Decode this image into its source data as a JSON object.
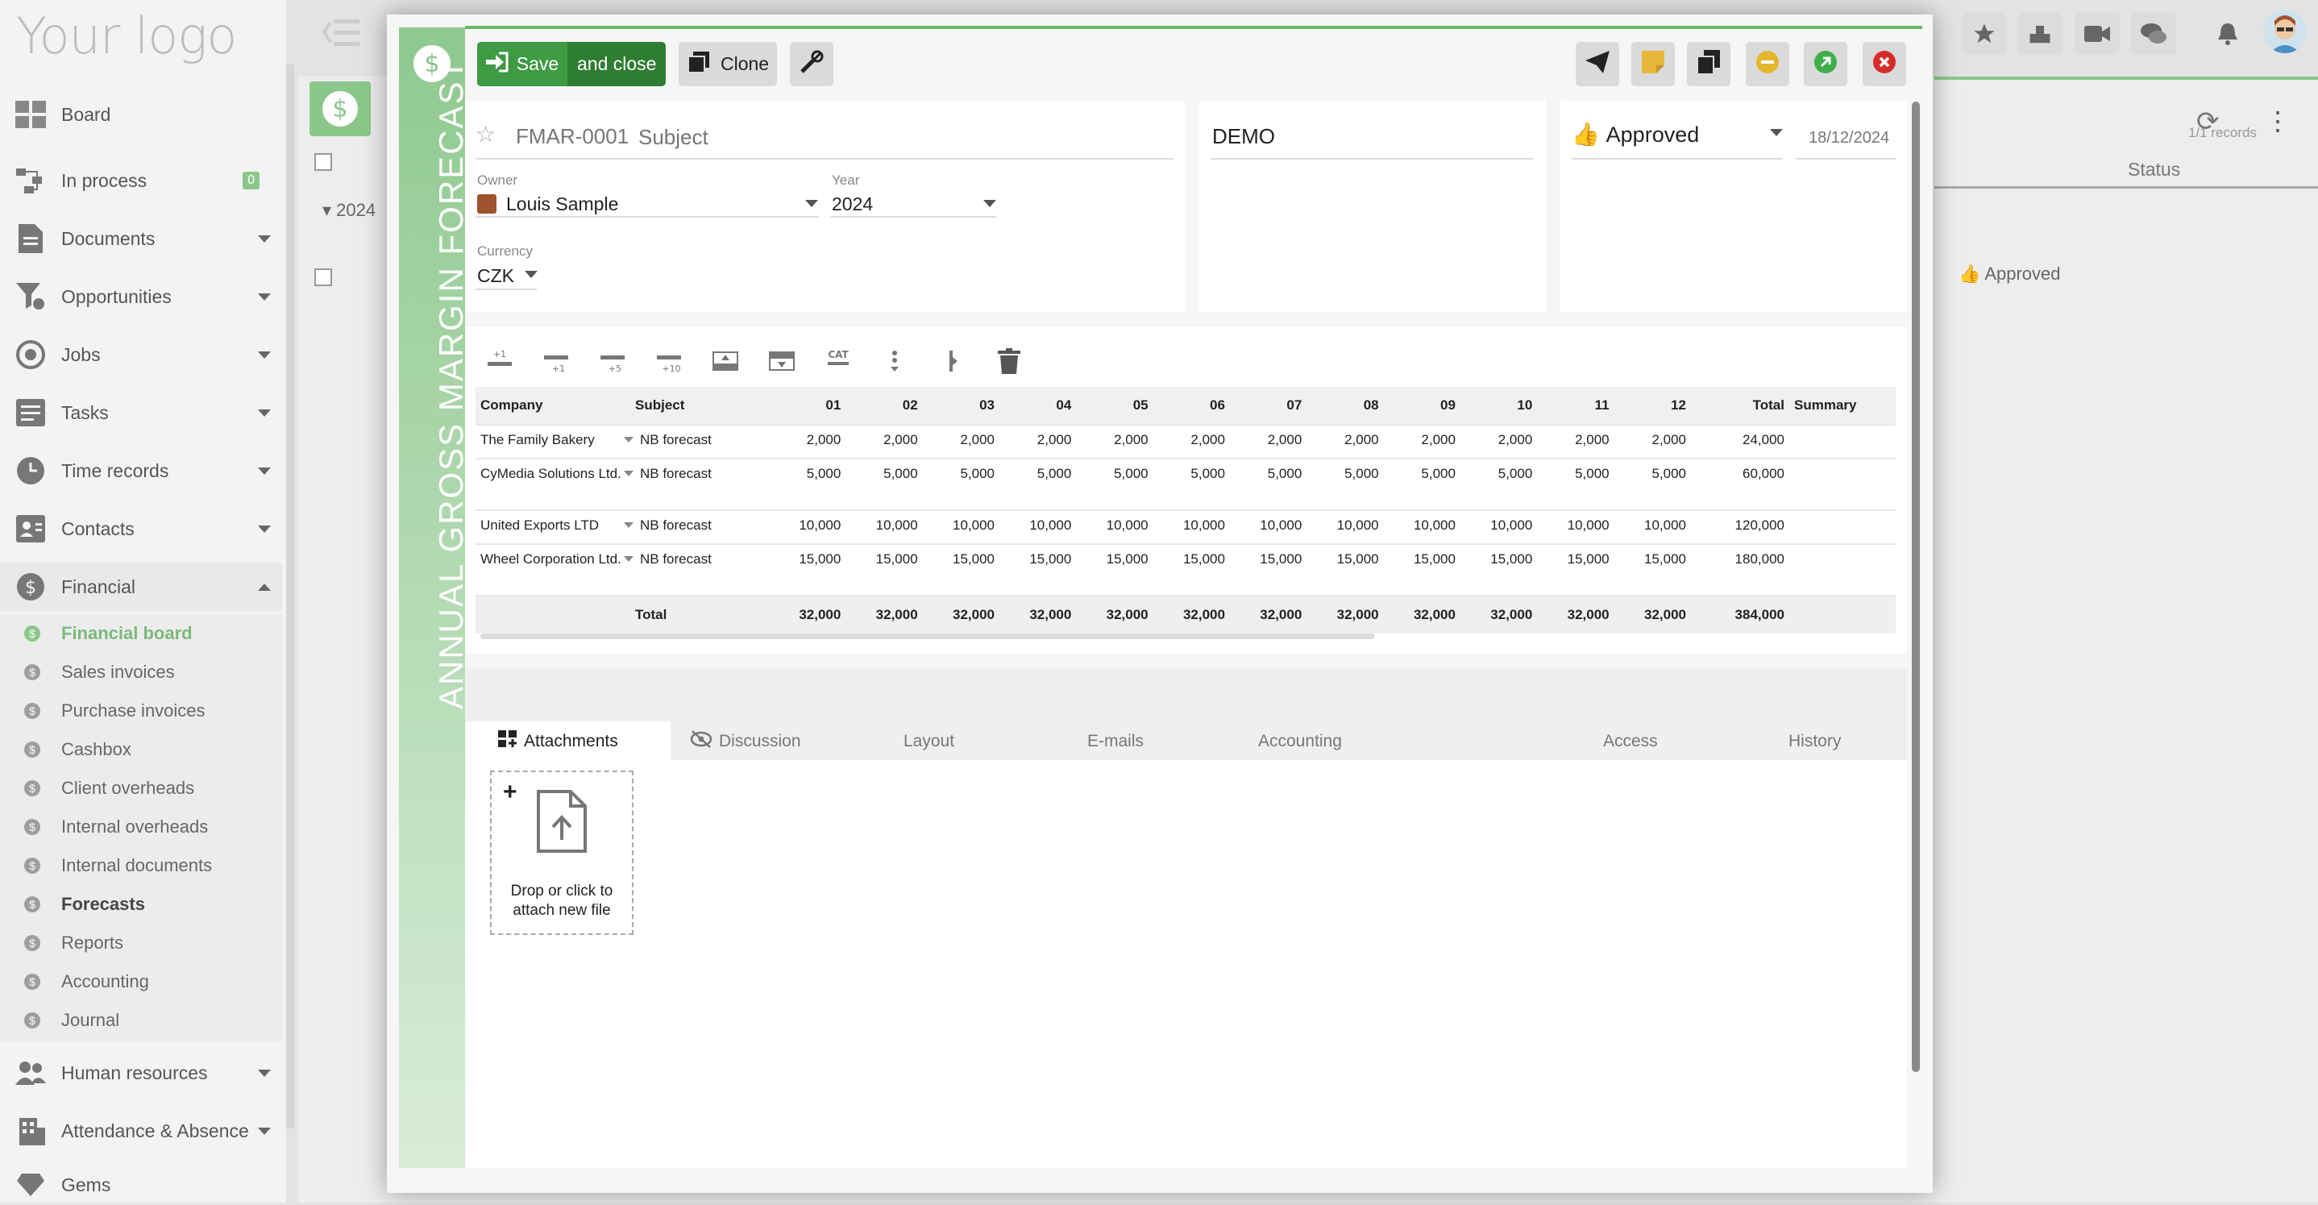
{
  "logo": "Your logo",
  "sidebar": {
    "items": [
      {
        "label": "Board",
        "icon": "board-icon"
      },
      {
        "label": "In process",
        "icon": "process-icon",
        "badge": "0"
      },
      {
        "label": "Documents",
        "icon": "document-icon"
      },
      {
        "label": "Opportunities",
        "icon": "funnel-icon"
      },
      {
        "label": "Jobs",
        "icon": "target-icon"
      },
      {
        "label": "Tasks",
        "icon": "tasks-icon"
      },
      {
        "label": "Time records",
        "icon": "clock-icon"
      },
      {
        "label": "Contacts",
        "icon": "contacts-icon"
      },
      {
        "label": "Financial",
        "icon": "dollar-icon"
      }
    ],
    "financial_sub": [
      "Financial board",
      "Sales invoices",
      "Purchase invoices",
      "Cashbox",
      "Client overheads",
      "Internal overheads",
      "Internal documents",
      "Forecasts",
      "Reports",
      "Accounting",
      "Journal"
    ],
    "bottom_items": [
      {
        "label": "Human resources",
        "icon": "people-icon"
      },
      {
        "label": "Attendance & Absence",
        "icon": "building-icon"
      },
      {
        "label": "Gems",
        "icon": "gem-icon"
      }
    ]
  },
  "background": {
    "group_year": "2024",
    "records": "1/1 records",
    "status_header": "Status",
    "row_status": "Approved"
  },
  "modal": {
    "title": "ANNUAL GROSS MARGIN FORECAST",
    "save_label": "Save",
    "save_close_label": "and close",
    "clone_label": "Clone",
    "code": "FMAR-0001",
    "subject_placeholder": "Subject",
    "owner_label": "Owner",
    "owner_value": "Louis Sample",
    "year_label": "Year",
    "year_value": "2024",
    "currency_label": "Currency",
    "currency_value": "CZK",
    "company_tag": "DEMO",
    "status": "Approved",
    "status_date": "18/12/2024",
    "colors": {
      "accent": "#6cb66c",
      "save": "#3f8f3f",
      "sticky": "#e7b53a",
      "minus": "#e3b72d",
      "go": "#3fae4a",
      "close": "#d62b2b"
    }
  },
  "toolbar": {
    "tools": [
      "add-row-1-icon",
      "insert-row-1-icon",
      "insert-row-5-icon",
      "insert-row-10-icon",
      "row-above-icon",
      "row-below-icon",
      "cat-icon",
      "vertical-dots-icon",
      "vertical-split-icon",
      "trash-icon"
    ],
    "labels": {
      "add1": "+1",
      "ins1": "+1",
      "ins5": "+5",
      "ins10": "+10",
      "cat": "CAT"
    }
  },
  "table": {
    "headers": [
      "Company",
      "Subject",
      "01",
      "02",
      "03",
      "04",
      "05",
      "06",
      "07",
      "08",
      "09",
      "10",
      "11",
      "12",
      "Total",
      "Summary"
    ],
    "rows": [
      {
        "company": "The Family Bakery",
        "subject": "NB forecast",
        "values": [
          "2,000",
          "2,000",
          "2,000",
          "2,000",
          "2,000",
          "2,000",
          "2,000",
          "2,000",
          "2,000",
          "2,000",
          "2,000",
          "2,000"
        ],
        "total": "24,000"
      },
      {
        "company": "CyMedia Solutions Ltd.",
        "subject": "NB forecast",
        "values": [
          "5,000",
          "5,000",
          "5,000",
          "5,000",
          "5,000",
          "5,000",
          "5,000",
          "5,000",
          "5,000",
          "5,000",
          "5,000",
          "5,000"
        ],
        "total": "60,000"
      },
      {
        "company": "United Exports LTD",
        "subject": "NB forecast",
        "values": [
          "10,000",
          "10,000",
          "10,000",
          "10,000",
          "10,000",
          "10,000",
          "10,000",
          "10,000",
          "10,000",
          "10,000",
          "10,000",
          "10,000"
        ],
        "total": "120,000"
      },
      {
        "company": "Wheel Corporation Ltd.",
        "subject": "NB forecast",
        "values": [
          "15,000",
          "15,000",
          "15,000",
          "15,000",
          "15,000",
          "15,000",
          "15,000",
          "15,000",
          "15,000",
          "15,000",
          "15,000",
          "15,000"
        ],
        "total": "180,000"
      }
    ],
    "total_row": {
      "label": "Total",
      "values": [
        "32,000",
        "32,000",
        "32,000",
        "32,000",
        "32,000",
        "32,000",
        "32,000",
        "32,000",
        "32,000",
        "32,000",
        "32,000",
        "32,000"
      ],
      "total": "384,000"
    }
  },
  "tabs": [
    {
      "label": "Attachments",
      "icon": "attachments-icon"
    },
    {
      "label": "Discussion",
      "icon": "eye-slash-icon"
    },
    {
      "label": "Layout"
    },
    {
      "label": "E-mails"
    },
    {
      "label": "Accounting"
    },
    {
      "label": "Access"
    },
    {
      "label": "History"
    }
  ],
  "attach": {
    "plus": "+",
    "hint_line1": "Drop or click to",
    "hint_line2": "attach new file"
  }
}
